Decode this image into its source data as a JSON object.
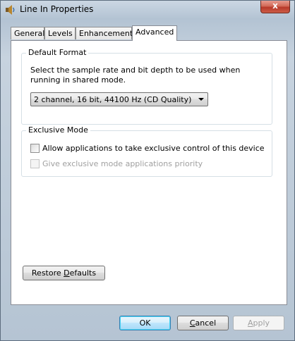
{
  "window": {
    "title": "Line In Properties",
    "close_label": "x"
  },
  "tabs": [
    {
      "label": "General"
    },
    {
      "label": "Levels"
    },
    {
      "label": "Enhancements"
    },
    {
      "label": "Advanced"
    }
  ],
  "default_format": {
    "label": "Default Format",
    "description": "Select the sample rate and bit depth to be used when running in shared mode.",
    "selected": "2 channel, 16 bit, 44100 Hz (CD Quality)"
  },
  "exclusive_mode": {
    "label": "Exclusive Mode",
    "allow_label": "Allow applications to take exclusive control of this device",
    "allow_checked": false,
    "priority_label": "Give exclusive mode applications priority",
    "priority_checked": false,
    "priority_enabled": false
  },
  "buttons": {
    "restore_prefix": "Restore ",
    "restore_hotkey": "D",
    "restore_suffix": "efaults",
    "ok": "OK",
    "cancel_hotkey": "C",
    "cancel_suffix": "ancel",
    "apply_hotkey": "A",
    "apply_suffix": "pply"
  }
}
